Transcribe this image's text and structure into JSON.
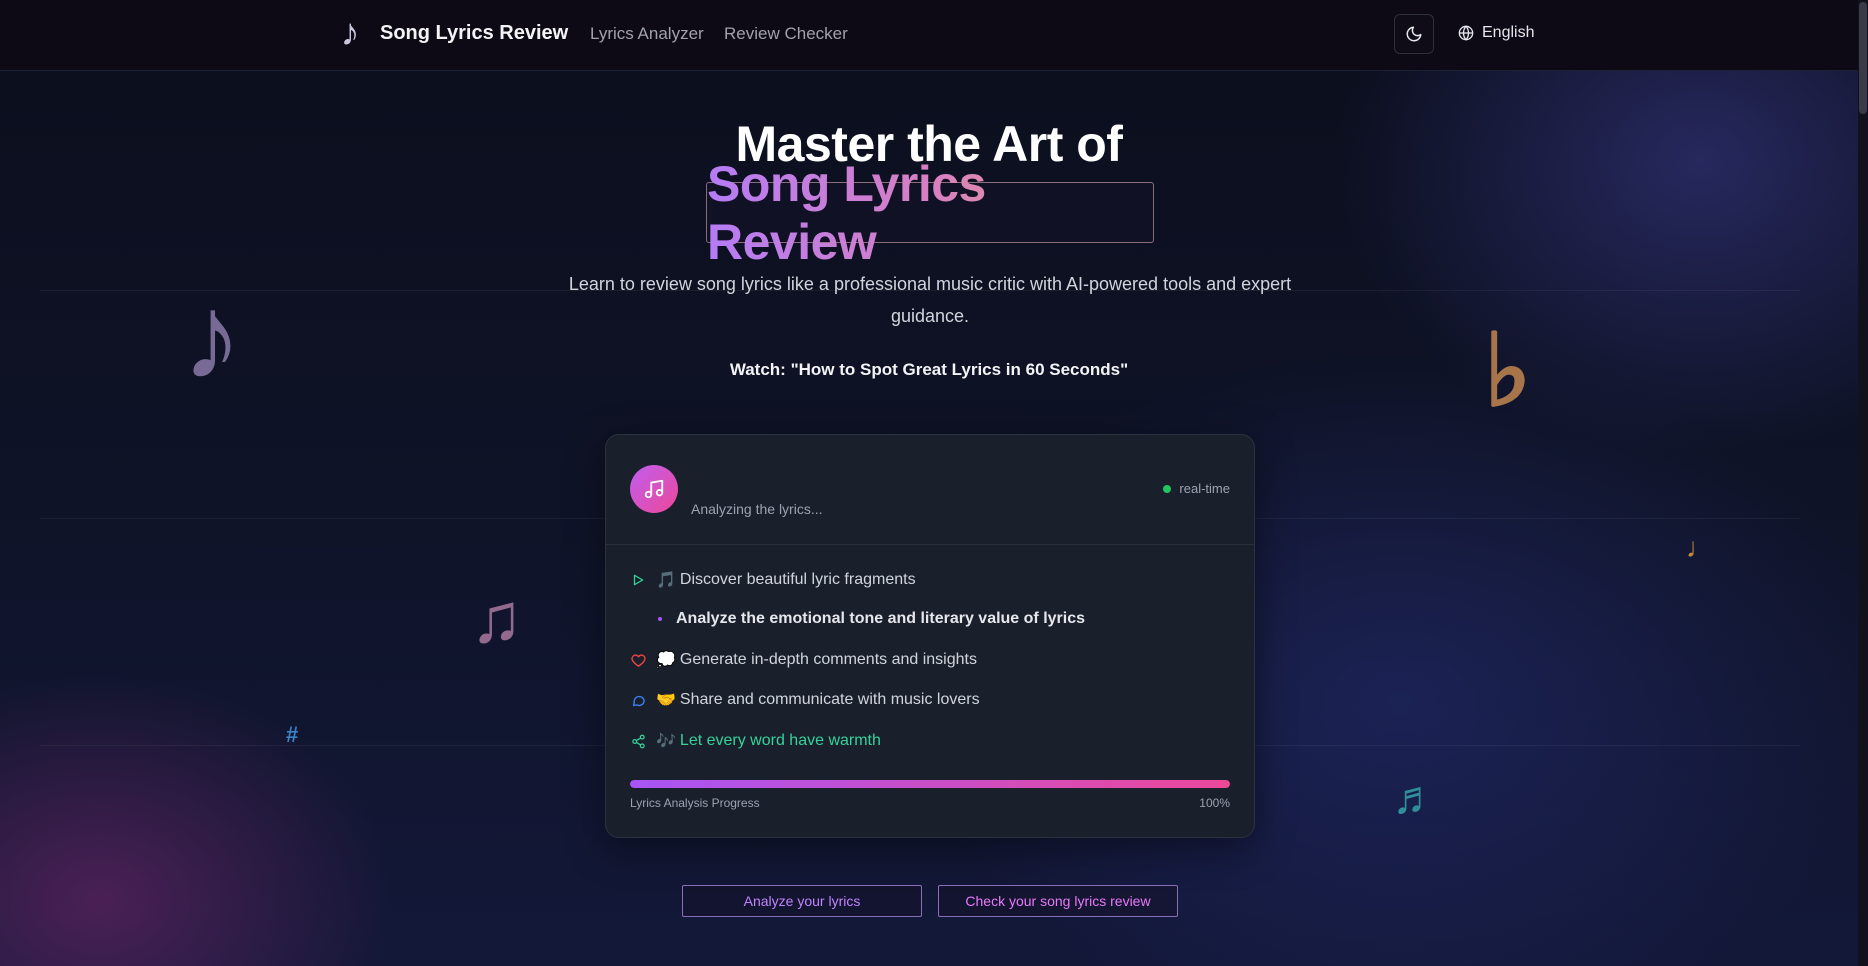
{
  "header": {
    "brand_name": "Song Lyrics Review",
    "brand_icon": "♪",
    "nav": [
      "Lyrics Analyzer",
      "Review Checker"
    ],
    "theme_toggle_icon": "moon-icon",
    "language": "English"
  },
  "hero": {
    "title_line1": "Master the Art of",
    "title_line2": "Song Lyrics Review",
    "subtitle": "Learn to review song lyrics like a professional music critic with AI-powered tools and expert guidance.",
    "watch_label": "Watch: \"How to Spot Great Lyrics in 60 Seconds\""
  },
  "decorations": {
    "notes": [
      "♪",
      "♫",
      "#",
      "♭",
      "♩",
      "♬"
    ]
  },
  "card": {
    "status": "Analyzing the lyrics...",
    "live_label": "real-time",
    "items": [
      {
        "icon": "play-icon",
        "emoji": "🎵",
        "text": "Discover beautiful lyric fragments"
      },
      {
        "icon": "bullet",
        "emoji": "",
        "text": "Analyze the emotional tone and literary value of lyrics"
      },
      {
        "icon": "heart-icon",
        "emoji": "💭",
        "text": "Generate in-depth comments and insights"
      },
      {
        "icon": "chat-icon",
        "emoji": "🤝",
        "text": "Share and communicate with music lovers"
      },
      {
        "icon": "share-icon",
        "emoji": "🎶",
        "text": "Let every word have warmth"
      }
    ],
    "progress_label": "Lyrics Analysis Progress",
    "progress_value": "100%",
    "progress_fraction": 1.0
  },
  "cta": {
    "primary": "Analyze your lyrics",
    "secondary": "Check your song lyrics review"
  },
  "colors": {
    "accent_purple": "#a855f7",
    "accent_pink": "#ec4899",
    "accent_green": "#34d399",
    "background": "#0f1327"
  }
}
